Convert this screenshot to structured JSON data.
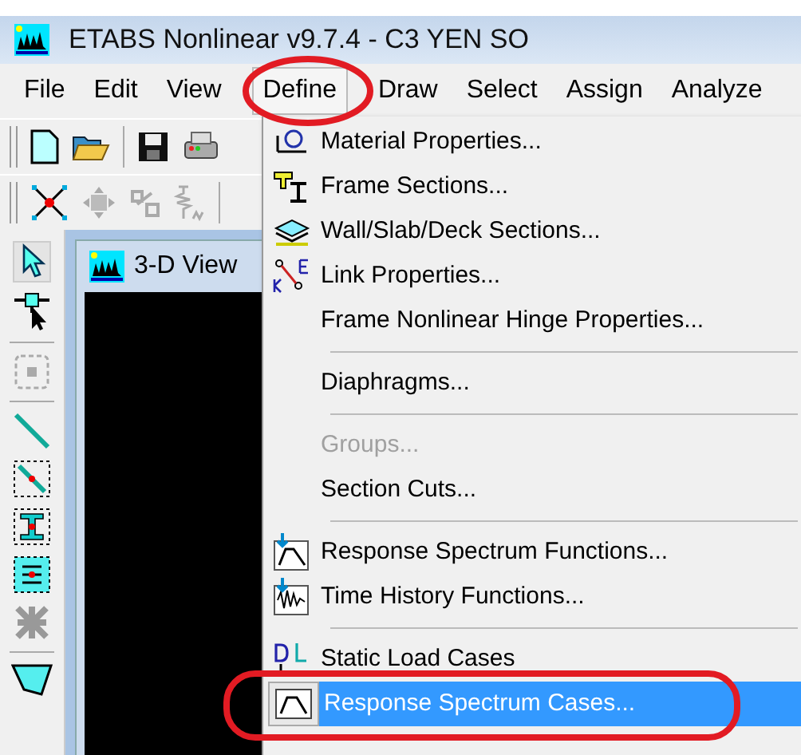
{
  "window": {
    "title": "ETABS Nonlinear v9.7.4 - C3 YEN SO"
  },
  "menubar": [
    {
      "label": "File",
      "selected": false
    },
    {
      "label": "Edit",
      "selected": false
    },
    {
      "label": "View",
      "selected": false
    },
    {
      "label": "Define",
      "selected": true
    },
    {
      "label": "Draw",
      "selected": false
    },
    {
      "label": "Select",
      "selected": false
    },
    {
      "label": "Assign",
      "selected": false
    },
    {
      "label": "Analyze",
      "selected": false
    }
  ],
  "child_window": {
    "title": "3-D View"
  },
  "define_menu": [
    {
      "kind": "material",
      "label": "Material Properties...",
      "disabled": false,
      "selected": false
    },
    {
      "kind": "frame",
      "label": "Frame Sections...",
      "disabled": false,
      "selected": false
    },
    {
      "kind": "wall",
      "label": "Wall/Slab/Deck Sections...",
      "disabled": false,
      "selected": false
    },
    {
      "kind": "link",
      "label": "Link Properties...",
      "disabled": false,
      "selected": false
    },
    {
      "kind": "plain",
      "label": "Frame Nonlinear Hinge Properties...",
      "disabled": false,
      "selected": false
    },
    {
      "kind": "separator"
    },
    {
      "kind": "plain",
      "label": "Diaphragms...",
      "disabled": false,
      "selected": false
    },
    {
      "kind": "separator"
    },
    {
      "kind": "plain",
      "label": "Groups...",
      "disabled": true,
      "selected": false
    },
    {
      "kind": "plain",
      "label": "Section Cuts...",
      "disabled": false,
      "selected": false
    },
    {
      "kind": "separator"
    },
    {
      "kind": "rsfunc",
      "label": "Response Spectrum Functions...",
      "disabled": false,
      "selected": false
    },
    {
      "kind": "thfunc",
      "label": "Time History Functions...",
      "disabled": false,
      "selected": false
    },
    {
      "kind": "separator"
    },
    {
      "kind": "static",
      "label": "Static Load Cases",
      "disabled": false,
      "selected": false
    },
    {
      "kind": "rscase",
      "label": "Response Spectrum Cases...",
      "disabled": false,
      "selected": true
    }
  ]
}
